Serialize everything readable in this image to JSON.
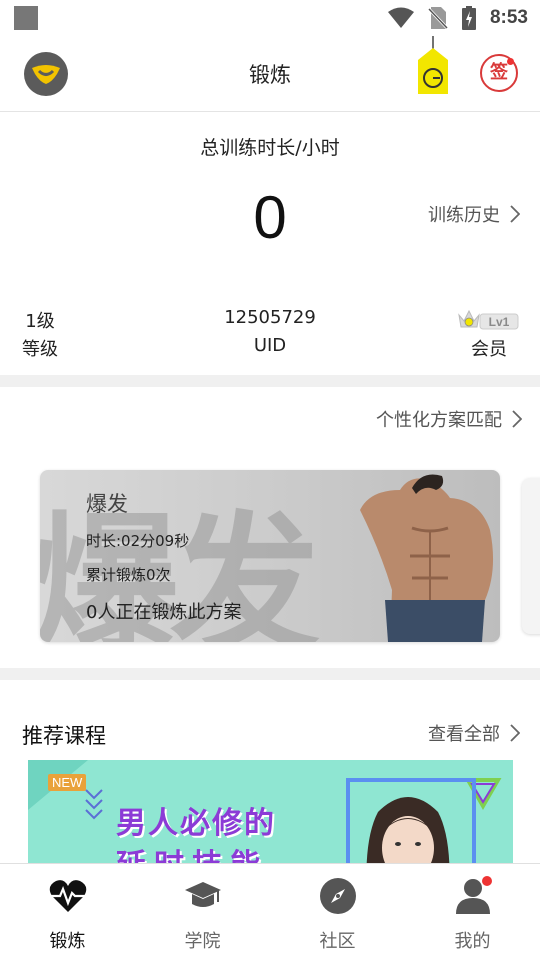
{
  "status_bar": {
    "time": "8:53"
  },
  "app_bar": {
    "title": "锻炼",
    "sign_label": "签"
  },
  "stats": {
    "total_label": "总训练时长/小时",
    "total_value": "0",
    "history_label": "训练历史",
    "level_value": "1级",
    "level_label": "等级",
    "uid_value": "12505729",
    "uid_label": "UID",
    "vip_badge_text": "Lv1",
    "vip_label": "会员"
  },
  "plan": {
    "match_label": "个性化方案匹配",
    "card": {
      "bg_text": "爆发",
      "name": "爆发",
      "duration": "时长:02分09秒",
      "count": "累计锻炼0次",
      "people": "0人正在锻炼此方案"
    }
  },
  "courses": {
    "title": "推荐课程",
    "see_all": "查看全部",
    "banner": {
      "badge": "NEW",
      "line1": "男人必修的",
      "line2": "延时技能"
    }
  },
  "nav": [
    {
      "label": "锻炼",
      "icon": "heartbeat-icon",
      "active": true
    },
    {
      "label": "学院",
      "icon": "graduation-cap-icon",
      "active": false
    },
    {
      "label": "社区",
      "icon": "compass-icon",
      "active": false
    },
    {
      "label": "我的",
      "icon": "user-icon",
      "active": false
    }
  ],
  "colors": {
    "accent_red": "#d93a3a",
    "tag_yellow": "#f2e600",
    "banner_bg": "#8fe6d2",
    "banner_text": "#8c3bd6"
  }
}
